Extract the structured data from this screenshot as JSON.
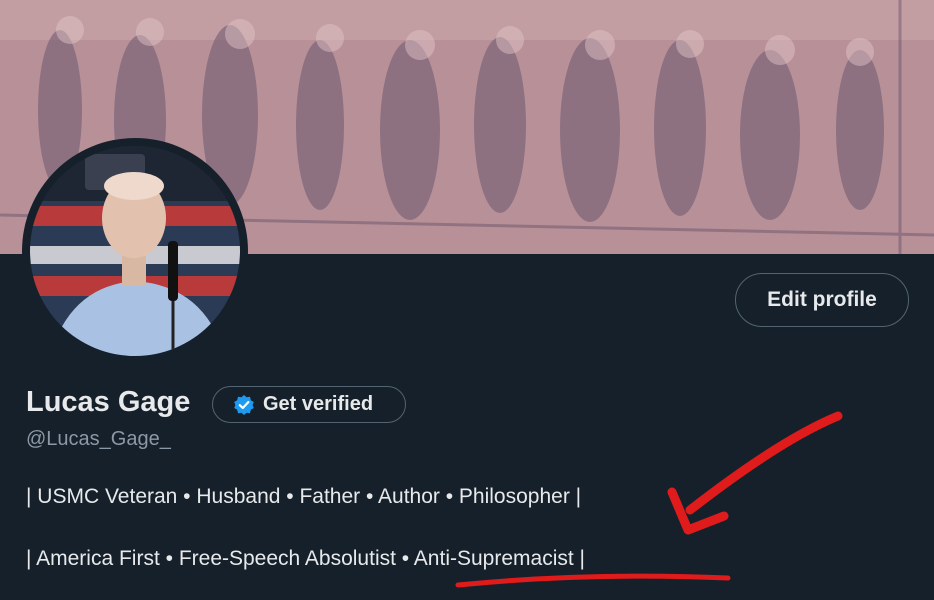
{
  "banner": {
    "description_icon": "relief-sculpture-banner"
  },
  "avatar": {
    "icon": "profile-photo"
  },
  "actions": {
    "edit_profile_label": "Edit profile"
  },
  "profile": {
    "display_name": "Lucas Gage",
    "get_verified_label": "Get verified",
    "handle": "@Lucas_Gage_",
    "bio_line_1": "| USMC Veteran • Husband • Father • Author • Philosopher |",
    "bio_line_2": "| America First • Free-Speech Absolutist • Anti-Supremacist |"
  },
  "colors": {
    "background": "#15202b",
    "text": "#e7e9ea",
    "muted": "#8b98a5",
    "border": "#536471",
    "verified_blue": "#1d9bf0",
    "annotation_red": "#e01b1b"
  }
}
